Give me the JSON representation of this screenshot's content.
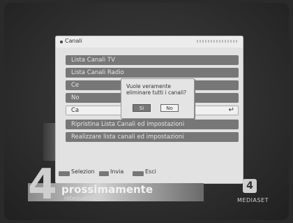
{
  "panel": {
    "header_title": "Canali",
    "menu_items": [
      {
        "label": "Lista Canali TV"
      },
      {
        "label": "Lista Canali Radio"
      },
      {
        "label": "Ce"
      },
      {
        "label": "No"
      },
      {
        "label": "Ca"
      },
      {
        "label": "Ripristina Lista Canali ed impostazioni"
      },
      {
        "label": "Realizzare lista canali ed impostazioni"
      }
    ],
    "enter_symbol": "↵"
  },
  "dialog": {
    "message": "Vuole veramente eliminare tutti i canali?",
    "yes_label": "Sì",
    "no_label": "No"
  },
  "footer": {
    "select_label": "Selezion",
    "send_label": "Invia",
    "exit_label": "Esci"
  },
  "banner": {
    "channel_number": "4",
    "title": "prossimamente",
    "subtitle": "retequattro"
  },
  "broadcaster": {
    "logo_glyph": "4",
    "name": "MEDIASET"
  }
}
